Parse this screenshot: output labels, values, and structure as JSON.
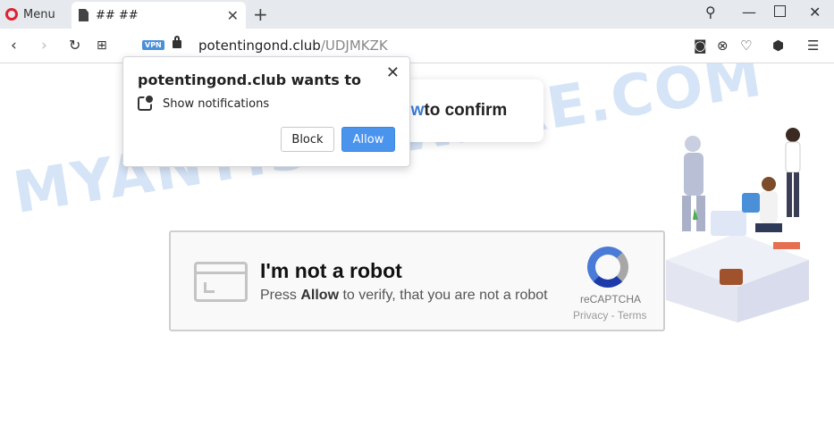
{
  "browser": {
    "menu_label": "Menu",
    "tab_title": "## ##",
    "vpn_badge": "VPN",
    "url_domain": "potentingond.club",
    "url_path": "/UDJMKZK"
  },
  "popup": {
    "title": "potentingond.club wants to",
    "permission": "Show notifications",
    "block_label": "Block",
    "allow_label": "Allow",
    "close_glyph": "✕"
  },
  "page": {
    "confirm_prefix": "ow",
    "confirm_suffix": " to confirm",
    "captcha_title": "I'm not a robot",
    "captcha_press": "Press ",
    "captcha_allow": "Allow",
    "captcha_rest": " to verify, that you are not a robot",
    "recaptcha_label": "reCAPTCHA",
    "recaptcha_links": "Privacy - Terms"
  },
  "watermark": "MYANTISPYWARE.COM",
  "colors": {
    "accent": "#4a94ee",
    "confirm_blue": "#3a7bd5",
    "opera_red": "#e0222f"
  }
}
